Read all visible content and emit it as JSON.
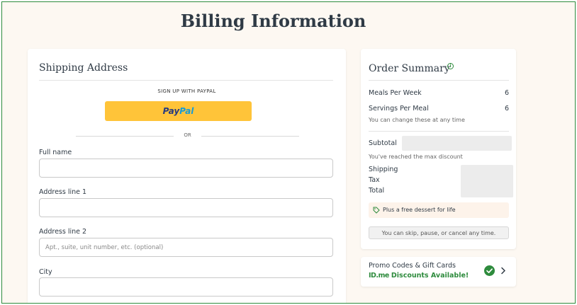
{
  "page": {
    "title": "Billing Information"
  },
  "shipping": {
    "heading": "Shipping Address",
    "paypal_caption": "SIGN UP WITH PAYPAL",
    "paypal_pay": "Pay",
    "paypal_pal": "Pal",
    "or_text": "OR",
    "fields": [
      {
        "label": "Full name",
        "value": "",
        "placeholder": ""
      },
      {
        "label": "Address line 1",
        "value": "",
        "placeholder": ""
      },
      {
        "label": "Address line 2",
        "value": "",
        "placeholder": "Apt., suite, unit number, etc. (optional)"
      },
      {
        "label": "City",
        "value": "",
        "placeholder": ""
      }
    ]
  },
  "summary": {
    "heading": "Order Summary",
    "info_icon": "i",
    "meals_per_week_label": "Meals Per Week",
    "meals_per_week_value": "6",
    "servings_per_meal_label": "Servings Per Meal",
    "servings_per_meal_value": "6",
    "change_note": "You can change these at any time",
    "subtotal_label": "Subtotal",
    "max_discount_note": "You've reached the max discount",
    "shipping_label": "Shipping",
    "tax_label": "Tax",
    "total_label": "Total",
    "dessert_text": "Plus a free dessert for life",
    "skip_text": "You can skip, pause, or cancel any time."
  },
  "promo": {
    "title": "Promo Codes & Gift Cards",
    "idme_logo": "ID.me",
    "discount_text": "Discounts Available!"
  },
  "colors": {
    "accent_green": "#2e8b3d",
    "paypal_yellow": "#ffc439",
    "background": "#fdf8f2",
    "heading_text": "#2f3a45"
  },
  "icons": [
    "info-icon",
    "tag-icon",
    "check-circle-icon",
    "chevron-right-icon"
  ]
}
